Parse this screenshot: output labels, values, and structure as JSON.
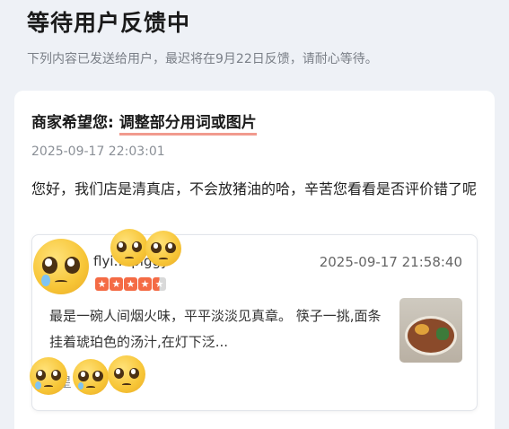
{
  "header": {
    "title": "等待用户反馈中",
    "subtitle": "下列内容已发送给用户，最迟将在9月22日反馈，请耐心等待。"
  },
  "merchant": {
    "prefix": "商家希望您: ",
    "highlight": "调整部分用词或图片",
    "timestamp": "2025-09-17 22:03:01",
    "message": "您好，我们店是清真店，不会放猪油的哈，辛苦您看看是否评价错了呢"
  },
  "review": {
    "reviewer_name": "flyi… piggy",
    "rating": 4.5,
    "timestamp": "2025-09-17 21:58:40",
    "text": "最是一碗人间烟火味，平平淡淡见真章。 筷子一挑,面条挂着琥珀色的汤汁,在灯下泛...",
    "footer": "/ 星",
    "photo_icon": "noodle-bowl-photo"
  },
  "colors": {
    "highlight_underline": "#f19a8e",
    "star": "#f46b45",
    "background": "#eef1f6"
  }
}
